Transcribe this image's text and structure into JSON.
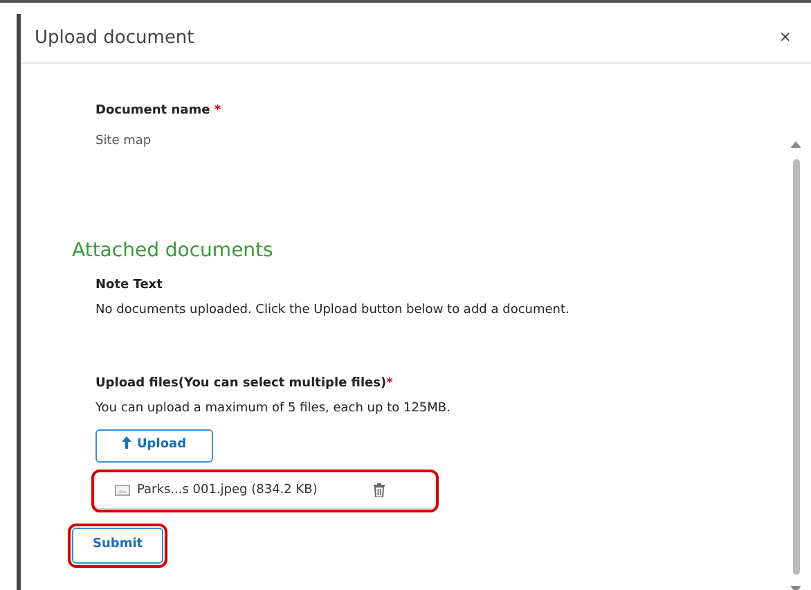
{
  "dialog": {
    "title": "Upload document",
    "close": "×"
  },
  "document_name": {
    "label": "Document name",
    "required": "*",
    "value": "Site map"
  },
  "attached": {
    "heading": "Attached documents",
    "note_label": "Note Text",
    "note": "No documents uploaded. Click the Upload button below to add a document."
  },
  "upload": {
    "label": "Upload files(You can select multiple files)",
    "required": "*",
    "hint": "You can upload a maximum of 5 files, each up to 125MB.",
    "button": "Upload",
    "files": [
      {
        "name": "Parks...s 001.jpeg (834.2 KB)",
        "highlighted": true
      }
    ]
  },
  "submit": {
    "label": "Submit",
    "highlighted": true
  }
}
